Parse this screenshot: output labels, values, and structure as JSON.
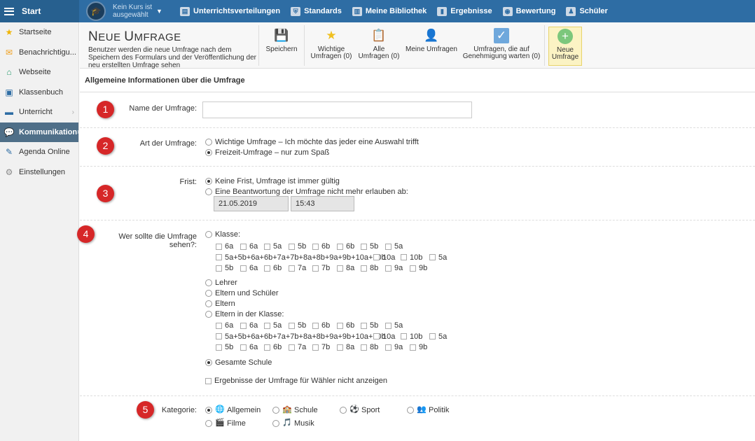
{
  "topbar": {
    "start": "Start",
    "course": "Kein Kurs ist ausgewählt",
    "nav": [
      {
        "label": "Unterrichtsverteilungen",
        "icon": "schedule-icon"
      },
      {
        "label": "Standards",
        "icon": "shield-icon"
      },
      {
        "label": "Meine Bibliothek",
        "icon": "library-icon"
      },
      {
        "label": "Ergebnisse",
        "icon": "chart-icon"
      },
      {
        "label": "Bewertung",
        "icon": "rating-icon"
      },
      {
        "label": "Schüler",
        "icon": "students-icon"
      }
    ]
  },
  "sidebar": {
    "items": [
      {
        "label": "Startseite",
        "icon": "star-icon"
      },
      {
        "label": "Benachrichtigu...",
        "icon": "mail-icon"
      },
      {
        "label": "Webseite",
        "icon": "home-icon"
      },
      {
        "label": "Klassenbuch",
        "icon": "book-icon"
      },
      {
        "label": "Unterricht",
        "icon": "briefcase-icon"
      },
      {
        "label": "Kommunikation",
        "icon": "chat-icon"
      },
      {
        "label": "Agenda Online",
        "icon": "pen-icon"
      },
      {
        "label": "Einstellungen",
        "icon": "gear-icon"
      }
    ]
  },
  "toolbar": {
    "title_big": "N",
    "title_rest": "EUE ",
    "title_big2": "U",
    "title_rest2": "MFRAGE",
    "description": "Benutzer werden die neue Umfrage nach dem Speichern des Formulars und der Veröffentlichung der neu erstellten Umfrage sehen",
    "save": "Speichern",
    "important_1": "Wichtige",
    "important_2": "Umfragen (0)",
    "all_1": "Alle",
    "all_2": "Umfragen (0)",
    "mine": "Meine Umfragen",
    "pending_1": "Umfragen, die auf",
    "pending_2": "Genehmigung warten (0)",
    "new_1": "Neue",
    "new_2": "Umfrage"
  },
  "form": {
    "section_title": "Allgemeine Informationen über die Umfrage",
    "badges": [
      "1",
      "2",
      "3",
      "4",
      "5"
    ],
    "name_label": "Name der Umfrage:",
    "name_value": "",
    "type_label": "Art der Umfrage:",
    "type_opt1": "Wichtige Umfrage – Ich möchte das jeder eine Auswahl trifft",
    "type_opt2": "Freizeit-Umfrage – nur zum Spaß",
    "deadline_label": "Frist:",
    "deadline_opt1": "Keine Frist, Umfrage ist immer gültig",
    "deadline_opt2": "Eine Beantwortung der Umfrage nicht mehr erlauben ab:",
    "date": "21.05.2019",
    "time": "15:43",
    "audience_label": "Wer sollte die Umfrage sehen?:",
    "klasse": "Klasse:",
    "row1": [
      "6a",
      "6a",
      "5a",
      "5b",
      "6b",
      "6b",
      "5b",
      "5a"
    ],
    "row2": [
      "5a+5b+6a+6b+7a+7b+8a+8b+9a+9b+10a+10b",
      "10a",
      "10b",
      "5a"
    ],
    "row3": [
      "5b",
      "6a",
      "6b",
      "7a",
      "7b",
      "8a",
      "8b",
      "9a",
      "9b"
    ],
    "lehrer": "Lehrer",
    "eltern_schueler": "Eltern und Schüler",
    "eltern": "Eltern",
    "eltern_klasse": "Eltern in der Klasse:",
    "gesamte": "Gesamte Schule",
    "hide_results": "Ergebnisse der Umfrage für Wähler nicht anzeigen",
    "category_label": "Kategorie:",
    "cat": [
      "Allgemein",
      "Schule",
      "Sport",
      "Politik",
      "Filme",
      "Musik"
    ]
  }
}
